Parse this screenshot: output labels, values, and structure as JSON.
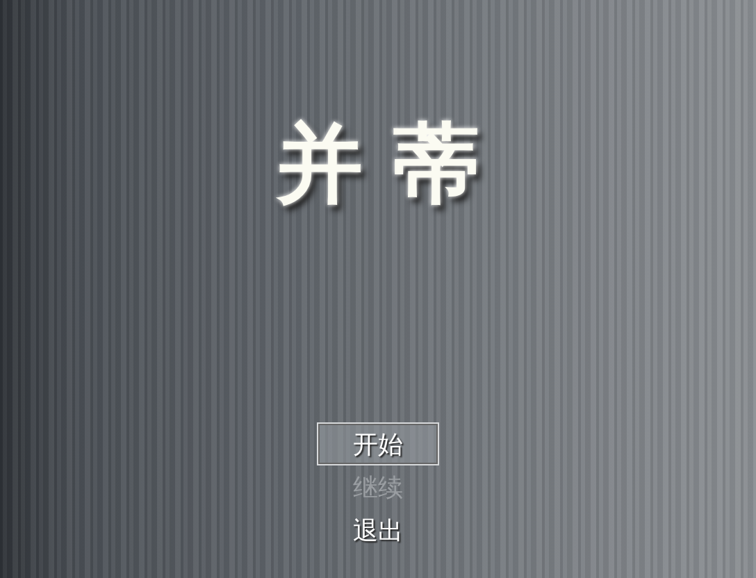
{
  "title": "并蒂",
  "menu": [
    {
      "label": "开始",
      "selected": true,
      "disabled": false
    },
    {
      "label": "继续",
      "selected": false,
      "disabled": true
    },
    {
      "label": "退出",
      "selected": false,
      "disabled": false
    }
  ]
}
